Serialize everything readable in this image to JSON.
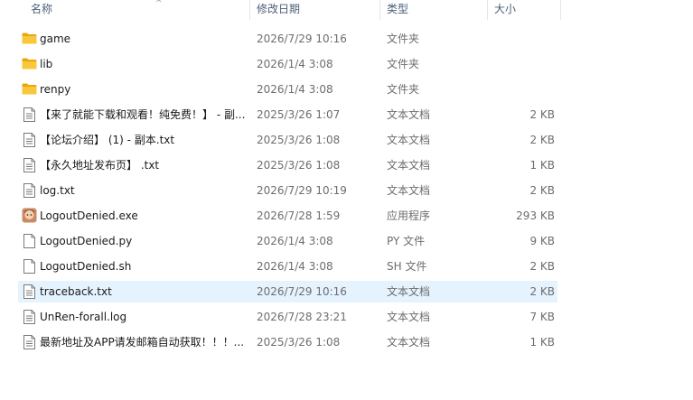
{
  "columns": {
    "name": "名称",
    "date": "修改日期",
    "type": "类型",
    "size": "大小"
  },
  "files": [
    {
      "name": "game",
      "date": "2026/7/29 10:16",
      "type": "文件夹",
      "size": "",
      "icon": "folder-icon"
    },
    {
      "name": "lib",
      "date": "2026/1/4 3:08",
      "type": "文件夹",
      "size": "",
      "icon": "folder-icon"
    },
    {
      "name": "renpy",
      "date": "2026/1/4 3:08",
      "type": "文件夹",
      "size": "",
      "icon": "folder-icon"
    },
    {
      "name": "【来了就能下载和观看！纯免费！】 - 副...",
      "date": "2025/3/26 1:07",
      "type": "文本文档",
      "size": "2 KB",
      "icon": "text-document-icon"
    },
    {
      "name": "【论坛介绍】 (1) - 副本.txt",
      "date": "2025/3/26 1:08",
      "type": "文本文档",
      "size": "2 KB",
      "icon": "text-document-icon"
    },
    {
      "name": "【永久地址发布页】 .txt",
      "date": "2025/3/26 1:08",
      "type": "文本文档",
      "size": "1 KB",
      "icon": "text-document-icon"
    },
    {
      "name": "log.txt",
      "date": "2026/7/29 10:19",
      "type": "文本文档",
      "size": "2 KB",
      "icon": "text-document-icon"
    },
    {
      "name": "LogoutDenied.exe",
      "date": "2026/7/28 1:59",
      "type": "应用程序",
      "size": "293 KB",
      "icon": "application-icon"
    },
    {
      "name": "LogoutDenied.py",
      "date": "2026/1/4 3:08",
      "type": "PY 文件",
      "size": "9 KB",
      "icon": "blank-file-icon"
    },
    {
      "name": "LogoutDenied.sh",
      "date": "2026/1/4 3:08",
      "type": "SH 文件",
      "size": "2 KB",
      "icon": "blank-file-icon"
    },
    {
      "name": "traceback.txt",
      "date": "2026/7/29 10:16",
      "type": "文本文档",
      "size": "2 KB",
      "icon": "text-document-icon",
      "selected": true
    },
    {
      "name": "UnRen-forall.log",
      "date": "2026/7/28 23:21",
      "type": "文本文档",
      "size": "7 KB",
      "icon": "text-document-icon"
    },
    {
      "name": "最新地址及APP请发邮箱自动获取！！！...",
      "date": "2025/3/26 1:08",
      "type": "文本文档",
      "size": "1 KB",
      "icon": "text-document-icon"
    }
  ],
  "colors": {
    "folder": "#f8c83b",
    "folder_dark": "#e8a70f",
    "selection": "#e5f3ff",
    "header_text": "#4c607a"
  }
}
